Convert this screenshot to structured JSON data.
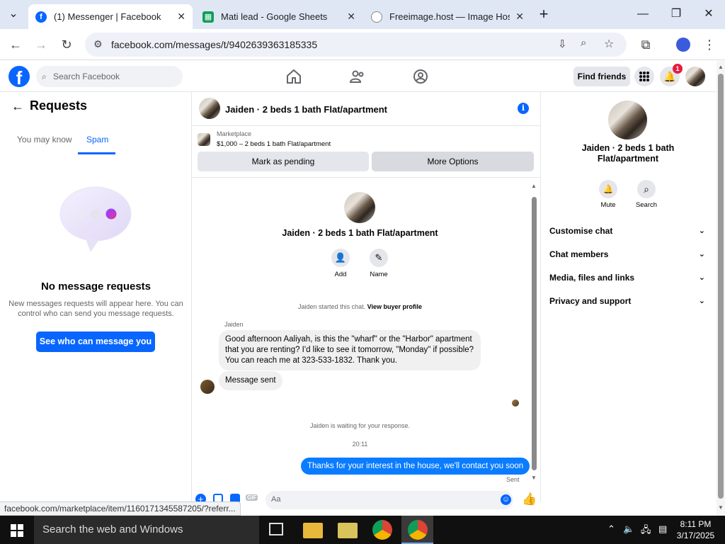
{
  "browser": {
    "tabs": [
      {
        "label": "(1) Messenger | Facebook",
        "active": true
      },
      {
        "label": "Mati lead - Google Sheets",
        "active": false
      },
      {
        "label": "Freeimage.host — Image Hosti",
        "active": false
      }
    ],
    "url": "facebook.com/messages/t/9402639363185335",
    "status_url": "facebook.com/marketplace/item/1160171345587205/?referr..."
  },
  "fb": {
    "search_placeholder": "Search Facebook",
    "find_friends": "Find friends",
    "notif_count": "1"
  },
  "requests": {
    "title": "Requests",
    "tabs": [
      "You may know",
      "Spam"
    ],
    "active_tab": "Spam",
    "empty_title": "No message requests",
    "empty_desc": "New messages requests will appear here. You can control who can send you message requests.",
    "cta": "See who can message you"
  },
  "chat": {
    "title": "Jaiden · 2 beds 1 bath Flat/apartment",
    "marketplace_label": "Marketplace",
    "listing": "$1,000 – 2 beds 1 bath Flat/apartment",
    "mark_pending": "Mark as pending",
    "more_options": "More Options",
    "profile_name": "Jaiden · 2 beds 1 bath Flat/apartment",
    "add_label": "Add",
    "name_label": "Name",
    "started_text": "Jaiden started this chat.",
    "view_buyer": "View buyer profile",
    "sender": "Jaiden",
    "msg1": "Good afternoon Aaliyah, is this the \"wharf\" or the \"Harbor\" apartment that you are renting?  I'd like to see it tomorrow, \"Monday\" if possible? You can reach me at 323-533-1832.  Thank you.",
    "msg2": "Message sent",
    "waiting": "Jaiden is waiting for your response.",
    "time": "20:11",
    "my_reply": "Thanks for your interest in the house, we'll contact you soon",
    "sent_label": "Sent",
    "composer_placeholder": "Aa"
  },
  "info": {
    "name": "Jaiden · 2 beds 1 bath Flat/apartment",
    "mute": "Mute",
    "search": "Search",
    "sections": [
      "Customise chat",
      "Chat members",
      "Media, files and links",
      "Privacy and support"
    ]
  },
  "taskbar": {
    "search": "Search the web and Windows",
    "time": "8:11 PM",
    "date": "3/17/2025"
  },
  "colors": {
    "fb_blue": "#0866ff",
    "bubble_blue": "#0a7cff"
  }
}
